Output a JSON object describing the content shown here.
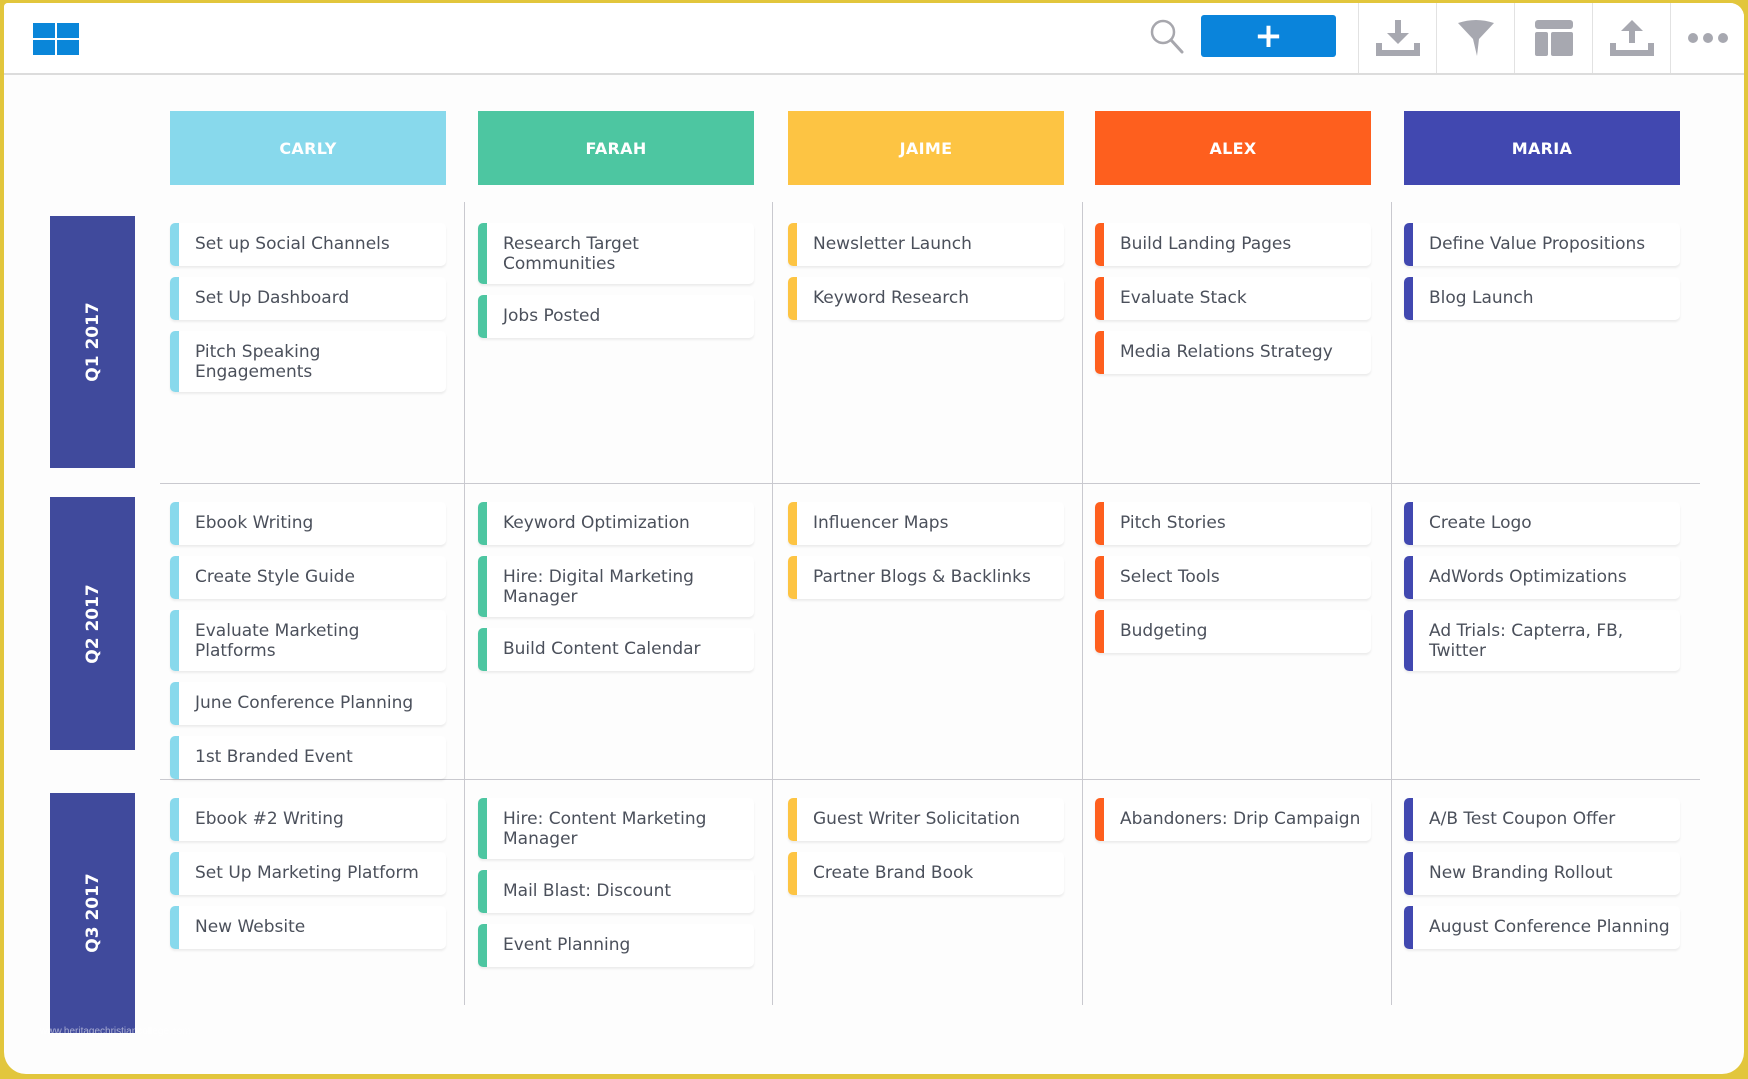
{
  "toolbar": {
    "logo_icon": "grid-icon",
    "search_icon": "search-icon",
    "add_label": "+",
    "buttons": [
      {
        "name": "download",
        "icon": "download-icon"
      },
      {
        "name": "filter",
        "icon": "filter-icon"
      },
      {
        "name": "layout",
        "icon": "layout-icon"
      },
      {
        "name": "upload",
        "icon": "upload-icon"
      },
      {
        "name": "more",
        "icon": "more-icon"
      }
    ],
    "accent": "#0a84db"
  },
  "columns": [
    {
      "label": "CARLY",
      "color": "#88d9ec"
    },
    {
      "label": "FARAH",
      "color": "#4dc6a1"
    },
    {
      "label": "JAIME",
      "color": "#fdc443"
    },
    {
      "label": "ALEX",
      "color": "#fe5f1e"
    },
    {
      "label": "MARIA",
      "color": "#4148b0"
    }
  ],
  "rows": [
    {
      "label": "Q1 2017",
      "cells": [
        [
          "Set up Social Channels",
          "Set Up Dashboard",
          "Pitch Speaking Engagements"
        ],
        [
          "Research Target Communities",
          "Jobs Posted"
        ],
        [
          "Newsletter Launch",
          "Keyword Research"
        ],
        [
          "Build Landing Pages",
          "Evaluate Stack",
          "Media Relations Strategy"
        ],
        [
          "Define Value Propositions",
          "Blog Launch"
        ]
      ]
    },
    {
      "label": "Q2 2017",
      "cells": [
        [
          "Ebook Writing",
          "Create Style Guide",
          "Evaluate Marketing Platforms",
          "June Conference Planning",
          "1st Branded Event"
        ],
        [
          "Keyword Optimization",
          "Hire: Digital Marketing Manager",
          "Build Content Calendar"
        ],
        [
          "Influencer Maps",
          "Partner Blogs & Backlinks"
        ],
        [
          "Pitch Stories",
          "Select Tools",
          "Budgeting"
        ],
        [
          "Create Logo",
          "AdWords Optimizations",
          "Ad Trials: Capterra, FB, Twitter"
        ]
      ]
    },
    {
      "label": "Q3 2017",
      "cells": [
        [
          "Ebook #2 Writing",
          "Set Up Marketing Platform",
          "New Website"
        ],
        [
          "Hire: Content Marketing Manager",
          "Mail Blast: Discount",
          "Event Planning"
        ],
        [
          "Guest Writer Solicitation",
          "Create Brand Book"
        ],
        [
          "Abandoners: Drip Campaign"
        ],
        [
          "A/B Test Coupon Offer",
          "New Branding Rollout",
          "August Conference Planning"
        ]
      ]
    }
  ],
  "row_label_color": "#404a9c",
  "watermark": "www.heritagechristiancollege.com"
}
